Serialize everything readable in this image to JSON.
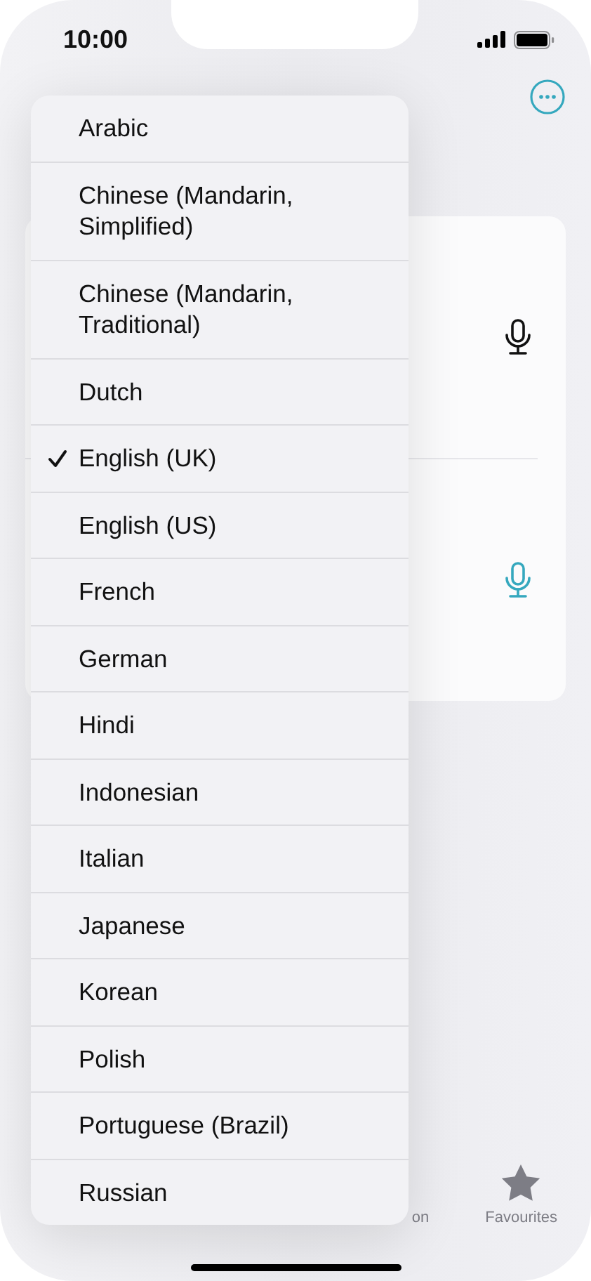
{
  "status_bar": {
    "time": "10:00"
  },
  "card": {
    "rows": [
      {
        "active": false
      },
      {
        "active": true
      }
    ]
  },
  "tab_bar": [
    {
      "label": "on",
      "selected": false
    },
    {
      "label": "Favourites",
      "selected": false,
      "kind": "star"
    }
  ],
  "language_menu": [
    {
      "label": "Arabic",
      "checked": false
    },
    {
      "label": "Chinese (Mandarin, Simplified)",
      "checked": false
    },
    {
      "label": "Chinese (Mandarin, Traditional)",
      "checked": false
    },
    {
      "label": "Dutch",
      "checked": false
    },
    {
      "label": "English (UK)",
      "checked": true
    },
    {
      "label": "English (US)",
      "checked": false
    },
    {
      "label": "French",
      "checked": false
    },
    {
      "label": "German",
      "checked": false
    },
    {
      "label": "Hindi",
      "checked": false
    },
    {
      "label": "Indonesian",
      "checked": false
    },
    {
      "label": "Italian",
      "checked": false
    },
    {
      "label": "Japanese",
      "checked": false
    },
    {
      "label": "Korean",
      "checked": false
    },
    {
      "label": "Polish",
      "checked": false
    },
    {
      "label": "Portuguese (Brazil)",
      "checked": false
    },
    {
      "label": "Russian",
      "checked": false
    }
  ]
}
